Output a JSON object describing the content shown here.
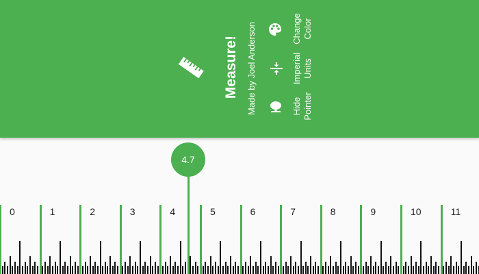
{
  "app": {
    "title": "Measure!",
    "subtitle": "Made by Joel Anderson"
  },
  "actions": [
    {
      "id": "hide-pointer",
      "line1": "Hide",
      "line2": "Pointer",
      "icon": "pointer-icon"
    },
    {
      "id": "imperial-units",
      "line1": "Imperial",
      "line2": "Units",
      "icon": "vertical-align-center-icon"
    },
    {
      "id": "change-color",
      "line1": "Change",
      "line2": "Color",
      "icon": "palette-icon"
    }
  ],
  "pointer": {
    "value": "4.7"
  },
  "ruler": {
    "numbers": [
      "0",
      "1",
      "2",
      "3",
      "4",
      "5",
      "6",
      "7",
      "8",
      "9",
      "10",
      "11"
    ],
    "accent_color": "#4caf50"
  },
  "colors": {
    "header_bg": "#4caf50",
    "ruler_bg": "#fafafa",
    "tick": "#111111"
  }
}
